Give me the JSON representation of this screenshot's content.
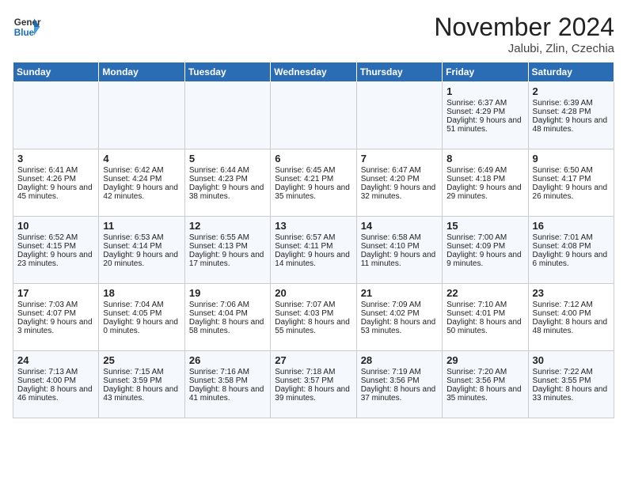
{
  "header": {
    "logo_line1": "General",
    "logo_line2": "Blue",
    "month_title": "November 2024",
    "location": "Jalubi, Zlin, Czechia"
  },
  "weekdays": [
    "Sunday",
    "Monday",
    "Tuesday",
    "Wednesday",
    "Thursday",
    "Friday",
    "Saturday"
  ],
  "weeks": [
    [
      {
        "day": "",
        "data": ""
      },
      {
        "day": "",
        "data": ""
      },
      {
        "day": "",
        "data": ""
      },
      {
        "day": "",
        "data": ""
      },
      {
        "day": "",
        "data": ""
      },
      {
        "day": "1",
        "data": "Sunrise: 6:37 AM\nSunset: 4:29 PM\nDaylight: 9 hours and 51 minutes."
      },
      {
        "day": "2",
        "data": "Sunrise: 6:39 AM\nSunset: 4:28 PM\nDaylight: 9 hours and 48 minutes."
      }
    ],
    [
      {
        "day": "3",
        "data": "Sunrise: 6:41 AM\nSunset: 4:26 PM\nDaylight: 9 hours and 45 minutes."
      },
      {
        "day": "4",
        "data": "Sunrise: 6:42 AM\nSunset: 4:24 PM\nDaylight: 9 hours and 42 minutes."
      },
      {
        "day": "5",
        "data": "Sunrise: 6:44 AM\nSunset: 4:23 PM\nDaylight: 9 hours and 38 minutes."
      },
      {
        "day": "6",
        "data": "Sunrise: 6:45 AM\nSunset: 4:21 PM\nDaylight: 9 hours and 35 minutes."
      },
      {
        "day": "7",
        "data": "Sunrise: 6:47 AM\nSunset: 4:20 PM\nDaylight: 9 hours and 32 minutes."
      },
      {
        "day": "8",
        "data": "Sunrise: 6:49 AM\nSunset: 4:18 PM\nDaylight: 9 hours and 29 minutes."
      },
      {
        "day": "9",
        "data": "Sunrise: 6:50 AM\nSunset: 4:17 PM\nDaylight: 9 hours and 26 minutes."
      }
    ],
    [
      {
        "day": "10",
        "data": "Sunrise: 6:52 AM\nSunset: 4:15 PM\nDaylight: 9 hours and 23 minutes."
      },
      {
        "day": "11",
        "data": "Sunrise: 6:53 AM\nSunset: 4:14 PM\nDaylight: 9 hours and 20 minutes."
      },
      {
        "day": "12",
        "data": "Sunrise: 6:55 AM\nSunset: 4:13 PM\nDaylight: 9 hours and 17 minutes."
      },
      {
        "day": "13",
        "data": "Sunrise: 6:57 AM\nSunset: 4:11 PM\nDaylight: 9 hours and 14 minutes."
      },
      {
        "day": "14",
        "data": "Sunrise: 6:58 AM\nSunset: 4:10 PM\nDaylight: 9 hours and 11 minutes."
      },
      {
        "day": "15",
        "data": "Sunrise: 7:00 AM\nSunset: 4:09 PM\nDaylight: 9 hours and 9 minutes."
      },
      {
        "day": "16",
        "data": "Sunrise: 7:01 AM\nSunset: 4:08 PM\nDaylight: 9 hours and 6 minutes."
      }
    ],
    [
      {
        "day": "17",
        "data": "Sunrise: 7:03 AM\nSunset: 4:07 PM\nDaylight: 9 hours and 3 minutes."
      },
      {
        "day": "18",
        "data": "Sunrise: 7:04 AM\nSunset: 4:05 PM\nDaylight: 9 hours and 0 minutes."
      },
      {
        "day": "19",
        "data": "Sunrise: 7:06 AM\nSunset: 4:04 PM\nDaylight: 8 hours and 58 minutes."
      },
      {
        "day": "20",
        "data": "Sunrise: 7:07 AM\nSunset: 4:03 PM\nDaylight: 8 hours and 55 minutes."
      },
      {
        "day": "21",
        "data": "Sunrise: 7:09 AM\nSunset: 4:02 PM\nDaylight: 8 hours and 53 minutes."
      },
      {
        "day": "22",
        "data": "Sunrise: 7:10 AM\nSunset: 4:01 PM\nDaylight: 8 hours and 50 minutes."
      },
      {
        "day": "23",
        "data": "Sunrise: 7:12 AM\nSunset: 4:00 PM\nDaylight: 8 hours and 48 minutes."
      }
    ],
    [
      {
        "day": "24",
        "data": "Sunrise: 7:13 AM\nSunset: 4:00 PM\nDaylight: 8 hours and 46 minutes."
      },
      {
        "day": "25",
        "data": "Sunrise: 7:15 AM\nSunset: 3:59 PM\nDaylight: 8 hours and 43 minutes."
      },
      {
        "day": "26",
        "data": "Sunrise: 7:16 AM\nSunset: 3:58 PM\nDaylight: 8 hours and 41 minutes."
      },
      {
        "day": "27",
        "data": "Sunrise: 7:18 AM\nSunset: 3:57 PM\nDaylight: 8 hours and 39 minutes."
      },
      {
        "day": "28",
        "data": "Sunrise: 7:19 AM\nSunset: 3:56 PM\nDaylight: 8 hours and 37 minutes."
      },
      {
        "day": "29",
        "data": "Sunrise: 7:20 AM\nSunset: 3:56 PM\nDaylight: 8 hours and 35 minutes."
      },
      {
        "day": "30",
        "data": "Sunrise: 7:22 AM\nSunset: 3:55 PM\nDaylight: 8 hours and 33 minutes."
      }
    ]
  ]
}
